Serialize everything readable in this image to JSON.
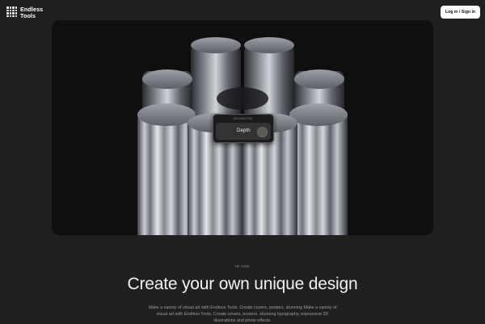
{
  "brand": {
    "name_line1": "Endless",
    "name_line2": "Tools",
    "logo_icon": "grid-logo-icon"
  },
  "header": {
    "login_label": "Log in / Sign in"
  },
  "hero": {
    "panel_title": "GEOMETRY",
    "panel_label": "Depth",
    "toggle_icon": "circle-toggle-icon"
  },
  "section": {
    "eyebrow": "IN USE",
    "headline": "Create your own unique design",
    "description": "Make a variety of visual art with Endless Tools. Create covers, posters, stunning Make a variety of visual art with Endless Tools. Create covers, posters, stunning typography, expressive 3D illustrations and photo effects."
  },
  "colors": {
    "background": "#202020",
    "hero_bg": "#0f0f10",
    "button_bg": "#ffffff"
  }
}
